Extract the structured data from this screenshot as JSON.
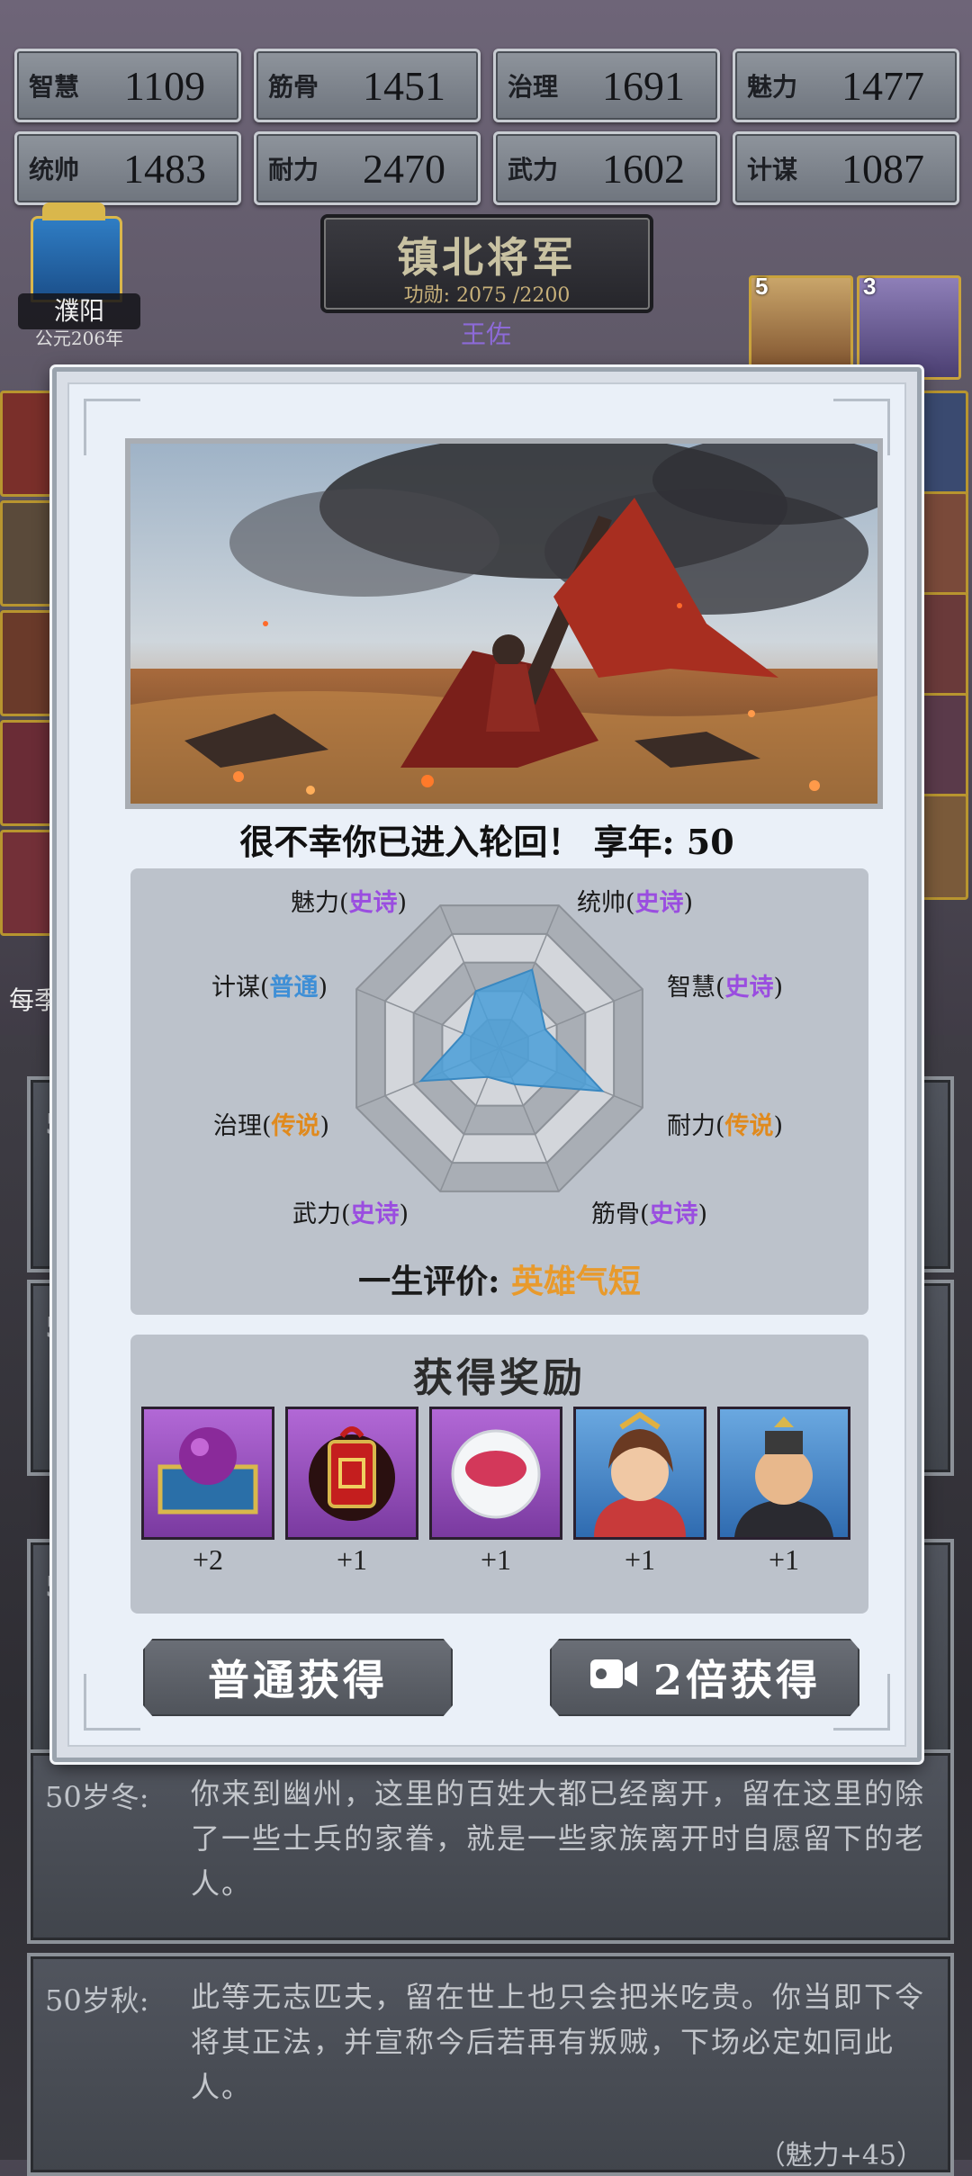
{
  "stats": [
    {
      "name": "智慧",
      "value": "1109"
    },
    {
      "name": "筋骨",
      "value": "1451"
    },
    {
      "name": "治理",
      "value": "1691"
    },
    {
      "name": "魅力",
      "value": "1477"
    },
    {
      "name": "统帅",
      "value": "1483"
    },
    {
      "name": "耐力",
      "value": "2470"
    },
    {
      "name": "武力",
      "value": "1602"
    },
    {
      "name": "计谋",
      "value": "1087"
    }
  ],
  "location": {
    "name": "濮阳",
    "year": "公元206年"
  },
  "rank": {
    "title": "镇北将军",
    "merit": "功勋: 2075 /2200",
    "general": "王佐"
  },
  "hero_cards": [
    {
      "count": "5"
    },
    {
      "count": "3"
    }
  ],
  "side_text": "每季",
  "modal": {
    "headline": "很不幸你已进入轮回！ 享年: 50",
    "radar_labels": [
      {
        "attr": "魅力",
        "quality": "史诗",
        "tier": "epic"
      },
      {
        "attr": "统帅",
        "quality": "史诗",
        "tier": "epic"
      },
      {
        "attr": "计谋",
        "quality": "普通",
        "tier": "common"
      },
      {
        "attr": "智慧",
        "quality": "史诗",
        "tier": "epic"
      },
      {
        "attr": "治理",
        "quality": "传说",
        "tier": "legend"
      },
      {
        "attr": "耐力",
        "quality": "传说",
        "tier": "legend"
      },
      {
        "attr": "武力",
        "quality": "史诗",
        "tier": "epic"
      },
      {
        "attr": "筋骨",
        "quality": "史诗",
        "tier": "epic"
      }
    ],
    "radar_values": {
      "统帅": 0.55,
      "智慧": 0.32,
      "耐力": 0.72,
      "筋骨": 0.25,
      "武力": 0.2,
      "治理": 0.55,
      "计谋": 0.25,
      "魅力": 0.4
    },
    "evaluation_label": "一生评价: ",
    "evaluation_value": "英雄气短",
    "reward_title": "获得奖励",
    "rewards": [
      {
        "icon": "treasure-chest-icon",
        "count": "+2"
      },
      {
        "icon": "red-lantern-icon",
        "count": "+1"
      },
      {
        "icon": "porcelain-bowl-icon",
        "count": "+1"
      },
      {
        "icon": "female-general-portrait",
        "count": "+1"
      },
      {
        "icon": "male-official-portrait",
        "count": "+1"
      }
    ],
    "normal_button": "普通获得",
    "double_button": "2倍获得"
  },
  "logs": [
    {
      "season": "50岁冬:",
      "text": "你来到幽州，这里的百姓大都已经离开，留在这里的除了一些士兵的家眷，就是一些家族离开时自愿留下的老人。",
      "extra": ""
    },
    {
      "season": "50岁秋:",
      "text": "此等无志匹夫，留在世上也只会把米吃贵。你当即下令将其正法，并宣称今后若再有叛贼，下场必定如同此人。",
      "extra": "（魅力+45）"
    }
  ],
  "hidden_log_prefix": "50"
}
